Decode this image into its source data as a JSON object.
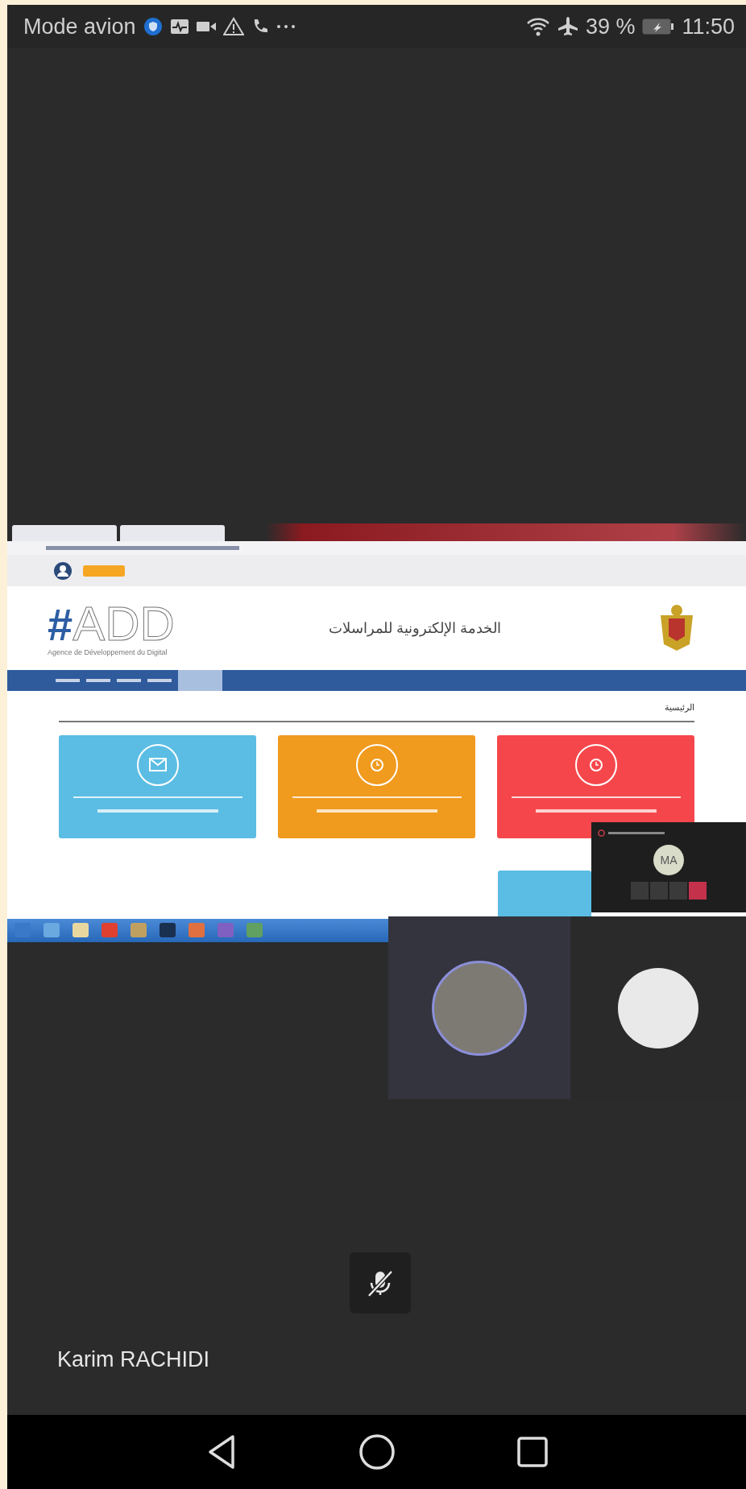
{
  "status_bar": {
    "mode_text": "Mode avion",
    "battery_text": "39 %",
    "time": "11:50"
  },
  "shared_screen": {
    "site_title": "الخدمة الإلكترونية للمراسلات",
    "logo_hash": "#",
    "logo_text": "ADD",
    "logo_subtitle": "Agence de Développement du Digital",
    "breadcrumb": "الرئيسية",
    "cards": [
      {
        "color": "#5bbde3"
      },
      {
        "color": "#f09a1e"
      },
      {
        "color": "#f5474b"
      }
    ]
  },
  "mini_window": {
    "initials": "MA"
  },
  "self_view": {
    "name": "Karim RACHIDI",
    "muted": true
  }
}
